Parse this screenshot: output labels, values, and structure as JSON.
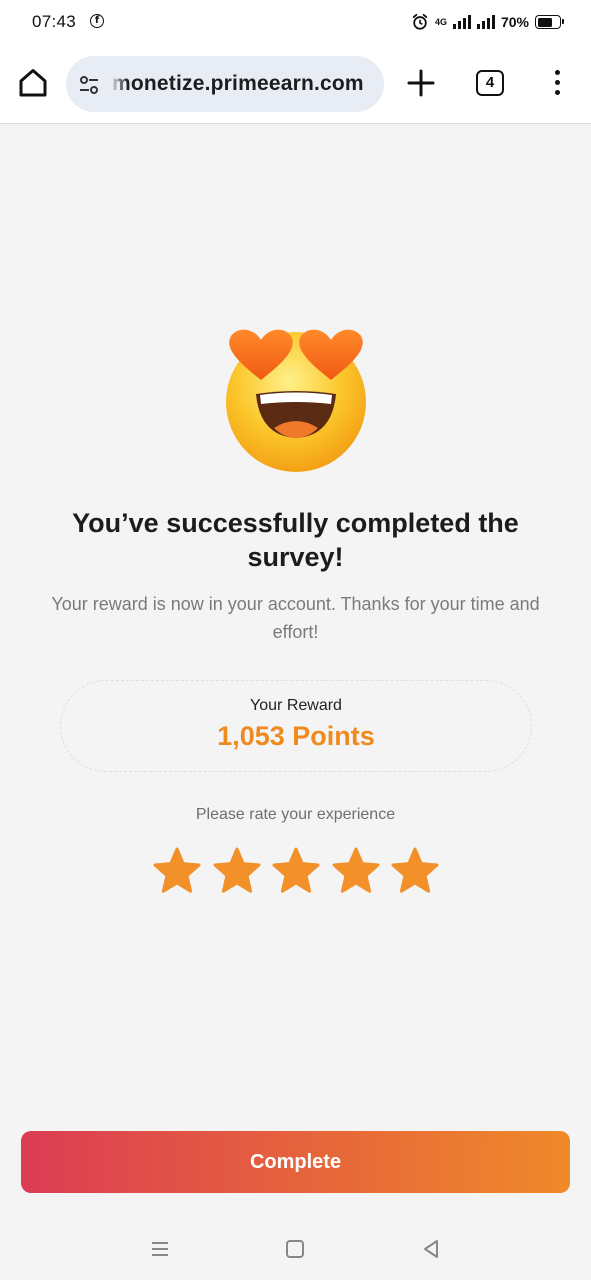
{
  "status_bar": {
    "time": "07:43",
    "network": "4G",
    "battery_percent": "70%",
    "battery_level": 0.7,
    "icons": [
      "facebook-icon",
      "alarm-icon",
      "signal-icon",
      "battery-icon"
    ]
  },
  "browser": {
    "url": "monetize.primeearn.com",
    "tab_count": "4",
    "icons": [
      "home-icon",
      "site-settings-icon",
      "new-tab-icon",
      "tabs-icon",
      "more-menu-icon"
    ]
  },
  "main": {
    "emoji": "heart-eyes-emoji",
    "headline": "You’ve successfully completed the survey!",
    "subtext": "Your reward is now in your account. Thanks for your time and effort!",
    "reward": {
      "label": "Your Reward",
      "value": "1,053 Points"
    },
    "rating": {
      "label": "Please rate your experience",
      "max_stars": 5,
      "selected": 5
    },
    "complete_button": "Complete"
  },
  "colors": {
    "accent_orange": "#ef8a1f",
    "star_orange": "#f2902a",
    "button_gradient_start": "#dc3c54",
    "button_gradient_end": "#ef8a2a",
    "background": "#f4f4f4"
  },
  "nav_bar": {
    "icons": [
      "recents-icon",
      "home-icon",
      "back-icon"
    ]
  }
}
